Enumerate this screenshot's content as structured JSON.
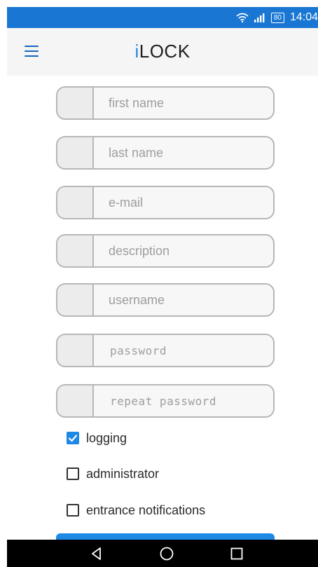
{
  "status_bar": {
    "battery": "80",
    "time": "14:04",
    "wifi_icon": "wifi-icon",
    "signal_icon": "signal-icon"
  },
  "app_bar": {
    "title_accent": "i",
    "title_rest": "LOCK",
    "menu_icon": "hamburger-menu-icon",
    "accent_color": "#1e88e5"
  },
  "form": {
    "fields": [
      {
        "placeholder": "first name",
        "value": ""
      },
      {
        "placeholder": "last name",
        "value": ""
      },
      {
        "placeholder": "e-mail",
        "value": ""
      },
      {
        "placeholder": "description",
        "value": ""
      },
      {
        "placeholder": "username",
        "value": ""
      },
      {
        "placeholder": "password",
        "value": ""
      },
      {
        "placeholder": "repeat password",
        "value": ""
      }
    ],
    "checkboxes": [
      {
        "label": "logging",
        "checked": true
      },
      {
        "label": "administrator",
        "checked": false
      },
      {
        "label": "entrance notifications",
        "checked": false
      }
    ]
  },
  "nav_bar": {
    "back_icon": "back-triangle-icon",
    "home_icon": "home-circle-icon",
    "recent_icon": "recent-apps-square-icon"
  }
}
